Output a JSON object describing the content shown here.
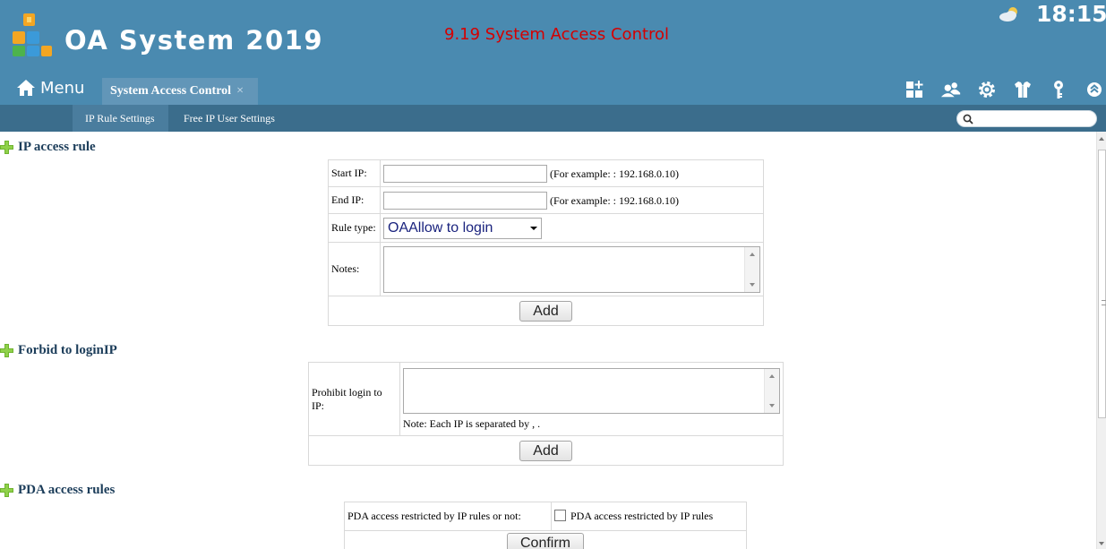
{
  "header": {
    "app_title": "OA System 2019",
    "page_heading": "9.19 System Access Control",
    "clock": "18:15",
    "menu_label": "Menu",
    "active_tab": "System Access Control",
    "tab_close": "×"
  },
  "subnav": {
    "items": [
      "IP Rule Settings",
      "Free IP User Settings"
    ],
    "search_placeholder": ""
  },
  "sections": {
    "ip_access_rule": {
      "title": "IP access rule",
      "start_ip_label": "Start IP:",
      "start_ip_value": "",
      "start_ip_hint": "(For example: : 192.168.0.10)",
      "end_ip_label": "End IP:",
      "end_ip_value": "",
      "end_ip_hint": "(For example: : 192.168.0.10)",
      "rule_type_label": "Rule type:",
      "rule_type_value": "OAAllow to login",
      "notes_label": "Notes:",
      "add_button": "Add"
    },
    "forbid_login_ip": {
      "title": "Forbid to loginIP",
      "prohibit_label": "Prohibit login to IP:",
      "note": "Note: Each IP is separated by , .",
      "add_button": "Add"
    },
    "pda_access_rules": {
      "title": "PDA access rules",
      "restricted_label": "PDA access restricted by IP rules or not:",
      "checkbox_label": "PDA access restricted by IP rules",
      "confirm_button": "Confirm"
    }
  },
  "colors": {
    "header_bg": "#4a8ab0",
    "subnav_bg": "#3b6d8c",
    "page_heading": "#d40000",
    "section_title": "#1c3d5a",
    "plus_icon": "#6fb32f"
  },
  "icons": [
    "logo-icon",
    "weather-icon",
    "home-icon",
    "apps-icon",
    "users-icon",
    "gear-icon",
    "shirt-icon",
    "key-icon",
    "collapse-up-icon",
    "search-icon",
    "plus-icon"
  ]
}
